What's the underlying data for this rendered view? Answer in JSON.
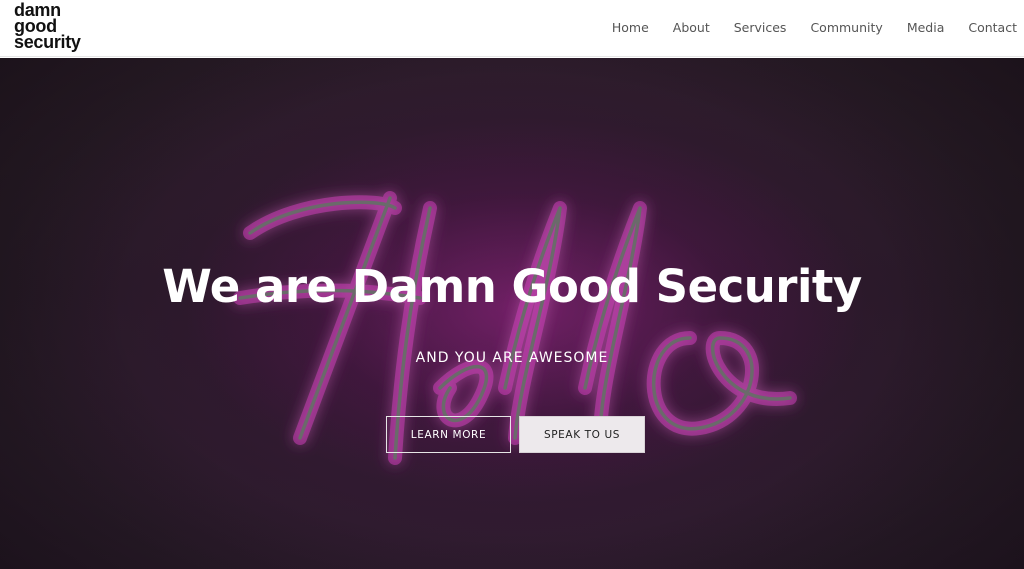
{
  "logo": {
    "line1": "damn",
    "line2": "good",
    "line3": "security"
  },
  "nav": {
    "items": [
      {
        "label": "Home"
      },
      {
        "label": "About"
      },
      {
        "label": "Services"
      },
      {
        "label": "Community"
      },
      {
        "label": "Media"
      },
      {
        "label": "Contact"
      }
    ]
  },
  "hero": {
    "title": "We are Damn Good Security",
    "subtitle": "AND YOU ARE AWESOME",
    "learn_more_label": "LEARN MORE",
    "speak_label": "SPEAK TO US",
    "background_text": "Hello"
  },
  "colors": {
    "neon_glow": "#a0288c",
    "hero_background": "#251a24",
    "button_solid": "#ede9ec"
  }
}
